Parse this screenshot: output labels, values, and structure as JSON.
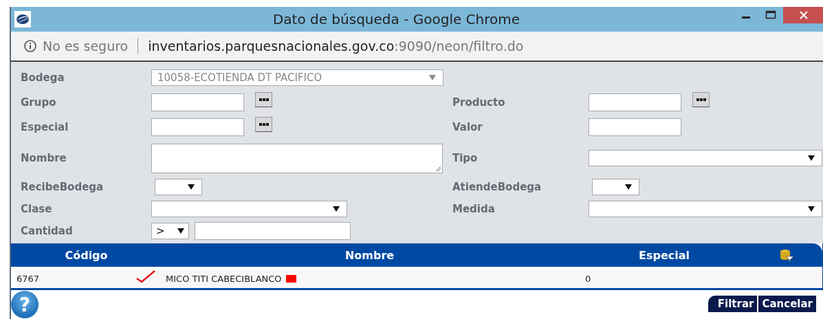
{
  "window": {
    "title": "Dato de búsqueda - Google Chrome"
  },
  "address_bar": {
    "security": "No es seguro",
    "host": "inventarios.parquesnacionales.gov.co",
    "path": ":9090/neon/filtro.do"
  },
  "form": {
    "rows": [
      {
        "left": {
          "label": "Bodega",
          "kind": "dropdown",
          "value": "10058-ECOTIENDA DT PACIFICO",
          "disabled": true
        }
      },
      {
        "left": {
          "label": "Grupo",
          "kind": "lookup"
        },
        "right": {
          "label": "Producto",
          "kind": "lookup"
        }
      },
      {
        "left": {
          "label": "Especial",
          "kind": "lookup"
        },
        "right": {
          "label": "Valor",
          "kind": "text"
        }
      },
      {
        "left": {
          "label": "Nombre",
          "kind": "memo"
        },
        "right": {
          "label": "Tipo",
          "kind": "dropdown",
          "disabled": false
        }
      },
      {
        "left": {
          "label": "RecibeBodega",
          "kind": "picker",
          "disabled": false
        },
        "right": {
          "label": "AtiendeBodega",
          "kind": "picker",
          "disabled": false
        }
      },
      {
        "left": {
          "label": "Clase",
          "kind": "dropdown",
          "disabled": false
        },
        "right": {
          "label": "Medida",
          "kind": "dropdown",
          "disabled": false
        }
      },
      {
        "left": {
          "label": "Cantidad",
          "kind": "compare",
          "operator": ">"
        }
      }
    ]
  },
  "table": {
    "columns": [
      "Código",
      "Nombre",
      "Especial"
    ],
    "rows": [
      {
        "codigo": "6767",
        "checked": true,
        "nombre": "MICO TITI CABECIBLANCO",
        "color": "#ff0000",
        "especial": "0"
      }
    ]
  },
  "help": {
    "icon": "?"
  },
  "buttons": [
    "Filtrar",
    "Cancelar"
  ]
}
